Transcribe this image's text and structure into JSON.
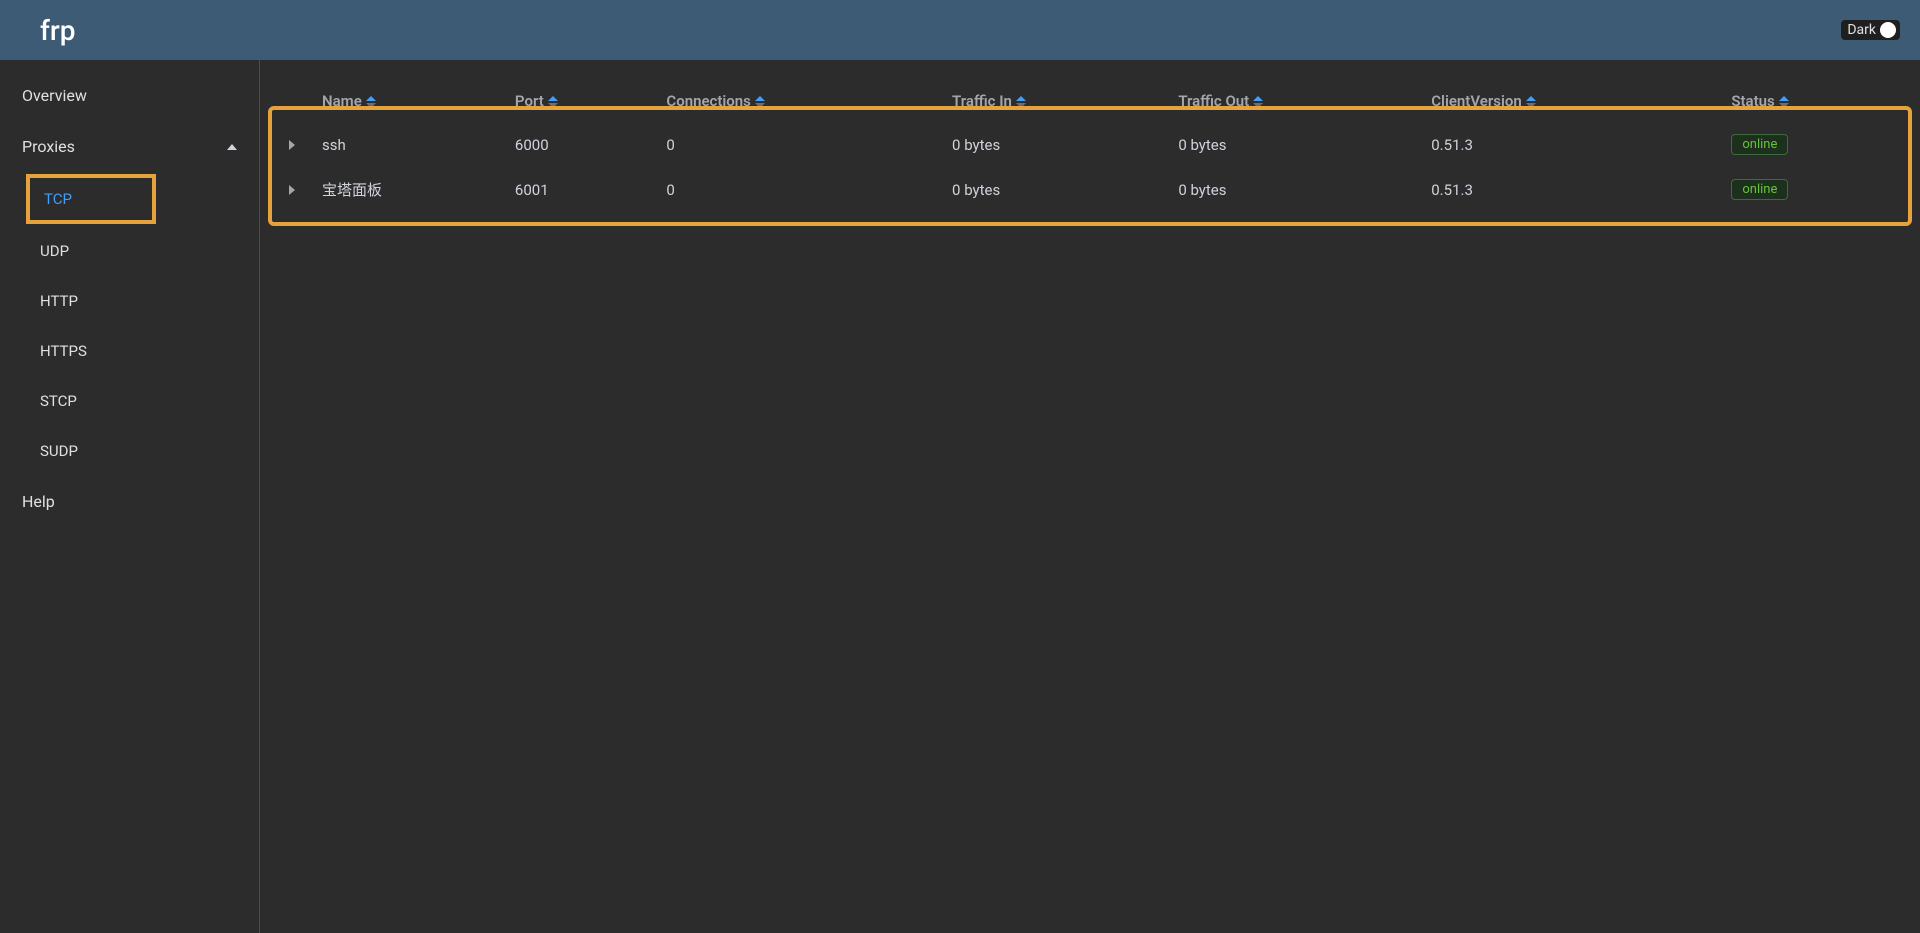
{
  "header": {
    "logo": "frp",
    "dark_label": "Dark"
  },
  "sidebar": {
    "overview": "Overview",
    "proxies_label": "Proxies",
    "help": "Help",
    "submenu": [
      {
        "label": "TCP",
        "active": true
      },
      {
        "label": "UDP",
        "active": false
      },
      {
        "label": "HTTP",
        "active": false
      },
      {
        "label": "HTTPS",
        "active": false
      },
      {
        "label": "STCP",
        "active": false
      },
      {
        "label": "SUDP",
        "active": false
      }
    ]
  },
  "table": {
    "headers": {
      "name": "Name",
      "port": "Port",
      "connections": "Connections",
      "traffic_in": "Traffic In",
      "traffic_out": "Traffic Out",
      "client_version": "ClientVersion",
      "status": "Status"
    },
    "rows": [
      {
        "name": "ssh",
        "port": "6000",
        "connections": "0",
        "traffic_in": "0 bytes",
        "traffic_out": "0 bytes",
        "client_version": "0.51.3",
        "status": "online"
      },
      {
        "name": "宝塔面板",
        "port": "6001",
        "connections": "0",
        "traffic_in": "0 bytes",
        "traffic_out": "0 bytes",
        "client_version": "0.51.3",
        "status": "online"
      }
    ]
  }
}
